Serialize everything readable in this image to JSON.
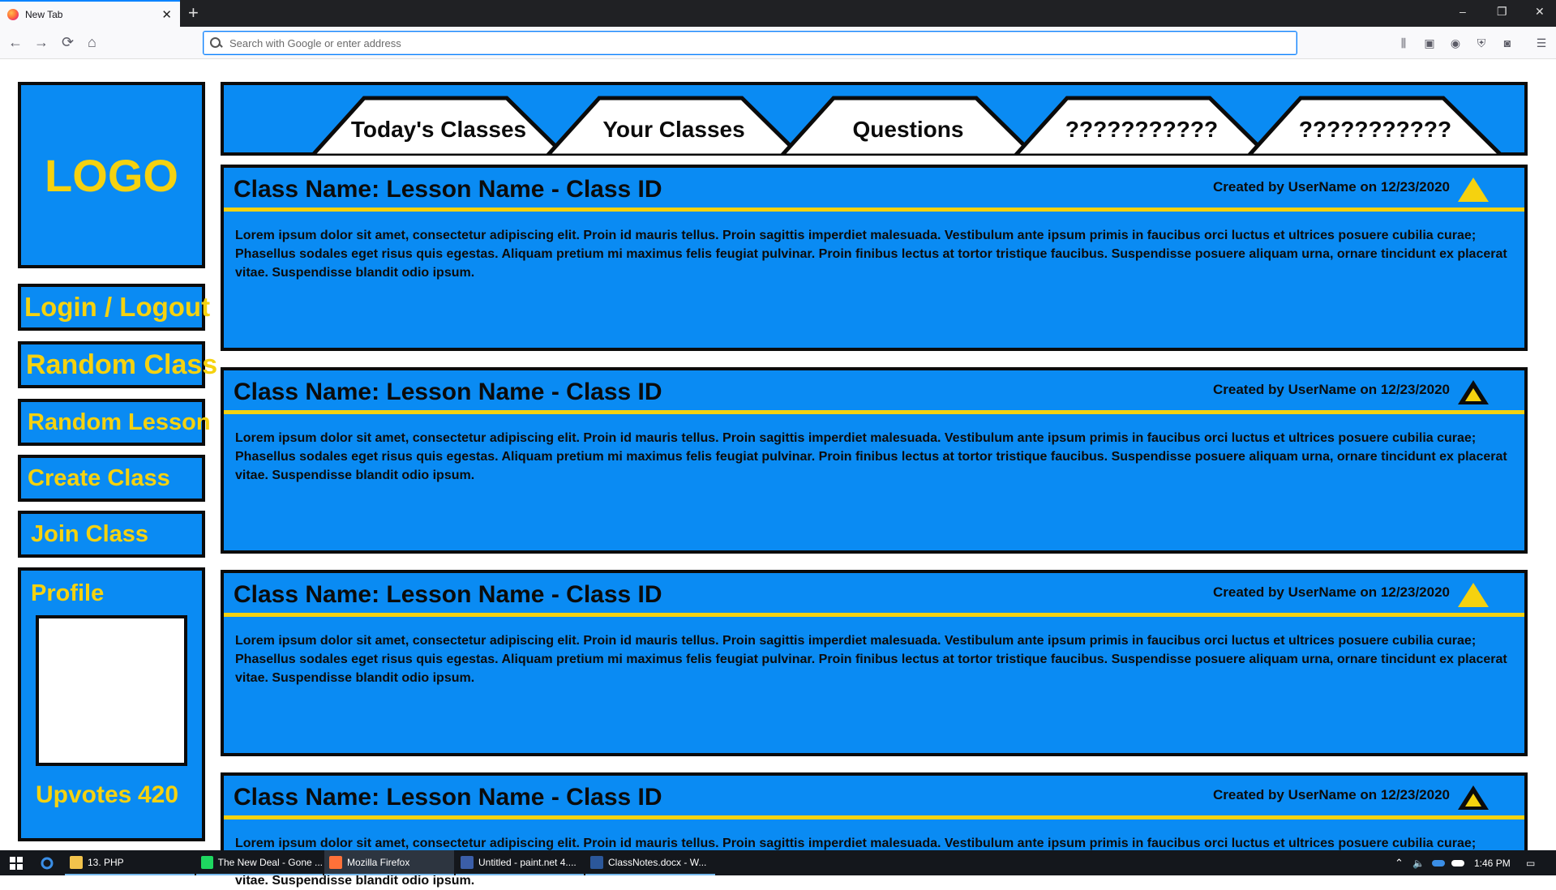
{
  "browser": {
    "tab_title": "New Tab",
    "tab_close": "✕",
    "new_tab": "+",
    "url_placeholder": "Search with Google or enter address",
    "win_min": "–",
    "win_max": "❐",
    "win_close": "✕",
    "back": "←",
    "forward": "→",
    "reload": "⟳",
    "home": "⌂",
    "toolbar_icons": [
      "library-icon",
      "sidebar-icon",
      "account-icon",
      "shield-icon",
      "extension-icon",
      "menu-icon"
    ]
  },
  "sidebar": {
    "logo": "LOGO",
    "login": "Login / Logout",
    "random_class": "Random Class",
    "random_lesson": "Random Lesson",
    "create_class": "Create Class",
    "join_class": "Join Class",
    "profile_label": "Profile",
    "upvotes_label": "Upvotes",
    "upvotes_value": "420"
  },
  "tabs": [
    {
      "label": "Today's Classes",
      "active": true
    },
    {
      "label": "Your Classes",
      "active": false
    },
    {
      "label": "Questions",
      "active": false
    },
    {
      "label": "???????????",
      "active": false
    },
    {
      "label": "???????????",
      "active": false
    }
  ],
  "cards": [
    {
      "title": "Class Name: Lesson Name - Class ID",
      "meta": "Created by UserName on 12/23/2020",
      "upvoted": true,
      "body": "Lorem ipsum dolor sit amet, consectetur adipiscing elit. Proin id mauris tellus. Proin sagittis imperdiet malesuada. Vestibulum ante ipsum primis in faucibus orci luctus et ultrices posuere cubilia curae; Phasellus sodales eget risus quis egestas. Aliquam pretium mi maximus felis feugiat pulvinar. Proin finibus lectus at tortor tristique faucibus. Suspendisse posuere aliquam urna, ornare tincidunt ex placerat vitae. Suspendisse blandit odio ipsum."
    },
    {
      "title": "Class Name: Lesson Name - Class ID",
      "meta": "Created by UserName on 12/23/2020",
      "upvoted": false,
      "body": "Lorem ipsum dolor sit amet, consectetur adipiscing elit. Proin id mauris tellus. Proin sagittis imperdiet malesuada. Vestibulum ante ipsum primis in faucibus orci luctus et ultrices posuere cubilia curae; Phasellus sodales eget risus quis egestas. Aliquam pretium mi maximus felis feugiat pulvinar. Proin finibus lectus at tortor tristique faucibus. Suspendisse posuere aliquam urna, ornare tincidunt ex placerat vitae. Suspendisse blandit odio ipsum."
    },
    {
      "title": "Class Name: Lesson Name - Class ID",
      "meta": "Created by UserName on 12/23/2020",
      "upvoted": true,
      "body": "Lorem ipsum dolor sit amet, consectetur adipiscing elit. Proin id mauris tellus. Proin sagittis imperdiet malesuada. Vestibulum ante ipsum primis in faucibus orci luctus et ultrices posuere cubilia curae; Phasellus sodales eget risus quis egestas. Aliquam pretium mi maximus felis feugiat pulvinar. Proin finibus lectus at tortor tristique faucibus. Suspendisse posuere aliquam urna, ornare tincidunt ex placerat vitae. Suspendisse blandit odio ipsum."
    },
    {
      "title": "Class Name: Lesson Name - Class ID",
      "meta": "Created by UserName on 12/23/2020",
      "upvoted": false,
      "body": "Lorem ipsum dolor sit amet, consectetur adipiscing elit. Proin id mauris tellus. Proin sagittis imperdiet malesuada. Vestibulum ante ipsum primis in faucibus orci luctus et ultrices posuere cubilia curae; Phasellus sodales eget risus quis egestas. Aliquam pretium mi maximus felis feugiat pulvinar. Proin finibus lectus at tortor tristique faucibus. Suspendisse posuere aliquam urna, ornare tincidunt ex placerat vitae. Suspendisse blandit odio ipsum."
    }
  ],
  "colors": {
    "panel_blue": "#0a8bf3",
    "accent_yellow": "#f5d20f",
    "outline": "#0b0b0b"
  },
  "taskbar": {
    "items": [
      {
        "label": "13. PHP",
        "icon": "folder-icon"
      },
      {
        "label": "The New Deal - Gone ...",
        "icon": "spotify-icon"
      },
      {
        "label": "Mozilla Firefox",
        "icon": "firefox-icon"
      },
      {
        "label": "Untitled - paint.net 4....",
        "icon": "paintnet-icon"
      },
      {
        "label": "ClassNotes.docx - W...",
        "icon": "word-icon"
      }
    ],
    "time": "1:46 PM"
  }
}
